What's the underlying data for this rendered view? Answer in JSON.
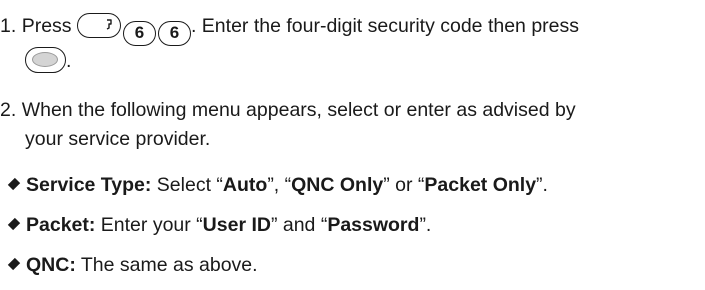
{
  "step1": {
    "number": "1.",
    "press_before": "Press",
    "key_digit_1": "6",
    "key_digit_2": "6",
    "text_after_keys": ". Enter the four-digit security code then press",
    "line2_end": "."
  },
  "step2": {
    "number": "2.",
    "line1": "When the following menu appears, select or enter as advised by",
    "line2": "your service provider."
  },
  "bullets": {
    "service_type": {
      "label": "Service Type:",
      "text_1": " Select “",
      "opt_1": "Auto",
      "text_2": "”, “",
      "opt_2": "QNC Only",
      "text_3": "” or “",
      "opt_3": "Packet Only",
      "text_4": "”."
    },
    "packet": {
      "label": "Packet:",
      "text_1": " Enter your “",
      "field_1": "User ID",
      "text_2": "” and “",
      "field_2": "Password",
      "text_3": "”."
    },
    "qnc": {
      "label": "QNC:",
      "text_1": " The same as above."
    }
  },
  "icons": {
    "menu_key": "menu-key-icon",
    "ok_key": "ok-key-icon",
    "bullet": "diamond-bullet-icon"
  }
}
